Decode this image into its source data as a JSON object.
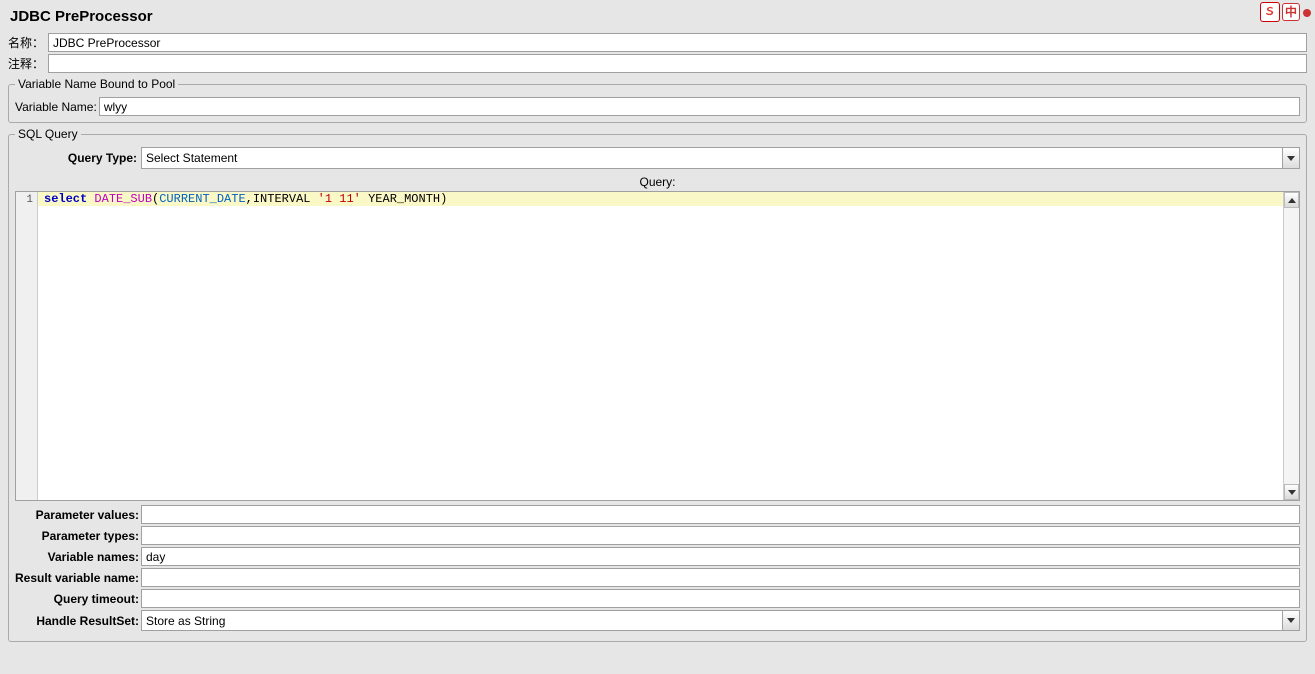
{
  "header": {
    "title": "JDBC PreProcessor"
  },
  "ime": {
    "zh": "中"
  },
  "basic": {
    "name_label": "名称：",
    "name_value": "JDBC PreProcessor",
    "comments_label": "注释：",
    "comments_value": ""
  },
  "pool": {
    "legend": "Variable Name Bound to Pool",
    "var_name_label": "Variable Name:",
    "var_name_value": "wlyy"
  },
  "sql": {
    "legend": "SQL Query",
    "query_type_label": "Query Type:",
    "query_type_value": "Select Statement",
    "query_label": "Query:",
    "gutter_lines": [
      1
    ],
    "tokens": [
      {
        "cls": "kw-select",
        "t": "select"
      },
      {
        "cls": "kw-plain",
        "t": " "
      },
      {
        "cls": "kw-func",
        "t": "DATE_SUB"
      },
      {
        "cls": "kw-plain",
        "t": "("
      },
      {
        "cls": "kw-ident",
        "t": "CURRENT_DATE"
      },
      {
        "cls": "kw-plain",
        "t": ",INTERVAL "
      },
      {
        "cls": "kw-str",
        "t": "'1 11'"
      },
      {
        "cls": "kw-plain",
        "t": " YEAR_MONTH)"
      }
    ],
    "params": {
      "param_values_label": "Parameter values:",
      "param_values_value": "",
      "param_types_label": "Parameter types:",
      "param_types_value": "",
      "variable_names_label": "Variable names:",
      "variable_names_value": "day",
      "result_var_label": "Result variable name:",
      "result_var_value": "",
      "query_timeout_label": "Query timeout:",
      "query_timeout_value": "",
      "handle_result_label": "Handle ResultSet:",
      "handle_result_value": "Store as String"
    }
  }
}
